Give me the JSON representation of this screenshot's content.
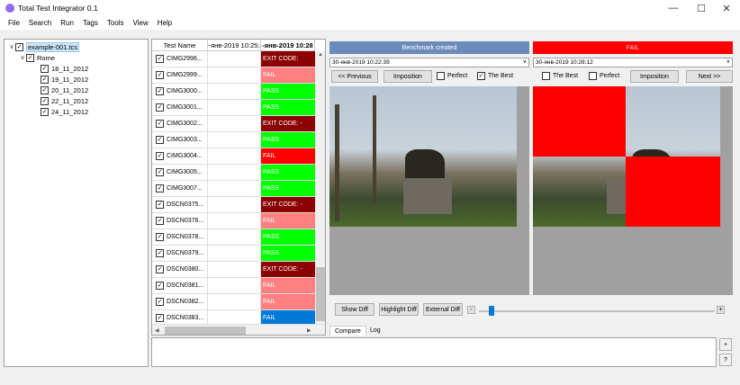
{
  "window": {
    "title": "Total Test Integrator 0.1"
  },
  "menu": [
    "File",
    "Search",
    "Run",
    "Tags",
    "Tools",
    "View",
    "Help"
  ],
  "tree": {
    "root": "example-001.tcs",
    "folder": "Rome",
    "items": [
      "18_11_2012",
      "19_11_2012",
      "20_11_2012",
      "22_11_2012",
      "24_11_2012"
    ]
  },
  "grid": {
    "headers": [
      "Test Name",
      "0-янв-2019 10:25:4",
      "-янв-2019 10:28"
    ],
    "rows": [
      {
        "name": "CIMG2996...",
        "status": "EXIT CODE: ",
        "color": "#8b0000"
      },
      {
        "name": "CIMG2999...",
        "status": "FAIL",
        "color": "#ff8080"
      },
      {
        "name": "CIMG3000...",
        "status": "PASS",
        "color": "#00ff00"
      },
      {
        "name": "CIMG3001...",
        "status": "PASS",
        "color": "#00ff00"
      },
      {
        "name": "CIMG3002...",
        "status": "EXIT CODE: -",
        "color": "#8b0000"
      },
      {
        "name": "CIMG3003...",
        "status": "PASS",
        "color": "#00ff00"
      },
      {
        "name": "CIMG3004...",
        "status": "FAIL",
        "color": "#ff0000"
      },
      {
        "name": "CIMG3005...",
        "status": "PASS",
        "color": "#00ff00"
      },
      {
        "name": "CIMG3007...",
        "status": "PASS",
        "color": "#00ff00"
      },
      {
        "name": "DSCN0375...",
        "status": "EXIT CODE: -",
        "color": "#8b0000"
      },
      {
        "name": "DSCN0376...",
        "status": "FAIL",
        "color": "#ff8080"
      },
      {
        "name": "DSCN0378...",
        "status": "PASS",
        "color": "#00ff00"
      },
      {
        "name": "DSCN0379...",
        "status": "PASS",
        "color": "#00ff00"
      },
      {
        "name": "DSCN0380...",
        "status": "EXIT CODE: -",
        "color": "#8b0000"
      },
      {
        "name": "DSCN0381...",
        "status": "FAIL",
        "color": "#ff8080"
      },
      {
        "name": "DSCN0382...",
        "status": "FAIL",
        "color": "#ff8080"
      },
      {
        "name": "DSCN0383...",
        "status": "FAIL",
        "color": "#0078d7"
      }
    ]
  },
  "compare": {
    "left_header": "Benchmark created",
    "right_header": "FAIL",
    "left_date": "30-янв-2019 10:22:39",
    "right_date": "30-янв-2019 10:28:12",
    "prev_label": "<< Previous",
    "next_label": "Next >>",
    "imposition_label": "Imposition",
    "perfect_label": "Perfect",
    "best_label": "The Best",
    "show_diff": "Show Diff",
    "highlight_diff": "Highlight Diff",
    "external_diff": "External Diff",
    "minus": "-",
    "plus": "+"
  },
  "tabs": [
    "Compare",
    "Log"
  ],
  "side_buttons": [
    "+",
    "?"
  ]
}
